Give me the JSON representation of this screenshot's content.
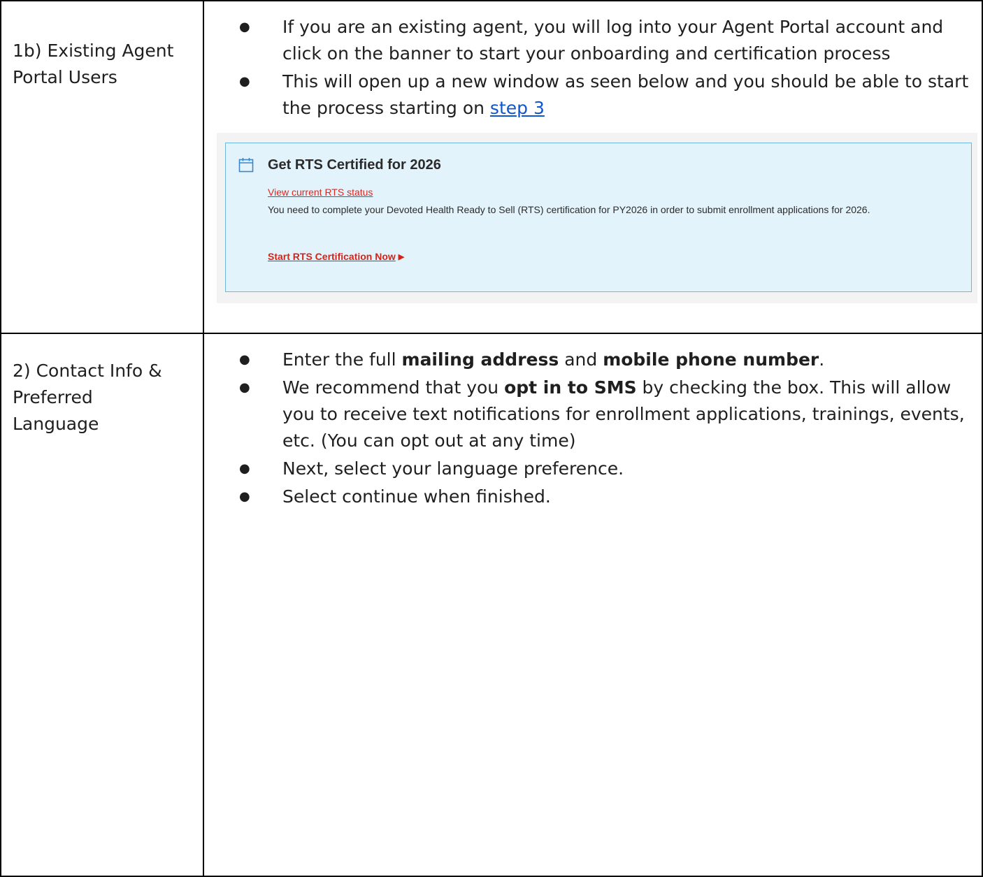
{
  "rows": [
    {
      "label": "1b) Existing Agent Portal Users",
      "bullets": [
        {
          "text": "If you are an existing agent, you will log into your Agent Portal account and click on the banner to start your onboarding and certification process"
        },
        {
          "text_before_link": "This will open up a new window as seen below  and you should be able to start the process starting on ",
          "link": "step 3"
        }
      ],
      "banner": {
        "title": "Get RTS Certified for 2026",
        "status_link": "View current RTS status",
        "body": "You need to complete your Devoted Health Ready to Sell (RTS) certification for PY2026 in order to submit enrollment applications for 2026.",
        "cta": "Start RTS Certification Now",
        "icon": "calendar-icon",
        "colors": {
          "background": "#e3f3fb",
          "border": "#6db6dc",
          "link": "#e0261c"
        }
      }
    },
    {
      "label_line1": "2) Contact Info &",
      "label_line2": "Preferred",
      "label_line3": "Language",
      "bullets": {
        "b1_pre": "Enter the full ",
        "b1_bold1": "mailing address",
        "b1_mid": " and ",
        "b1_bold2": "mobile phone number",
        "b1_post": ".",
        "b2_pre": "We recommend that you ",
        "b2_bold": "opt in to SMS",
        "b2_post": " by checking the box. This will allow you to receive text notifications for enrollment applications, trainings, events, etc. (You can opt out at any time)",
        "b3": "Next, select your language preference.",
        "b4": "Select continue when finished."
      }
    }
  ]
}
